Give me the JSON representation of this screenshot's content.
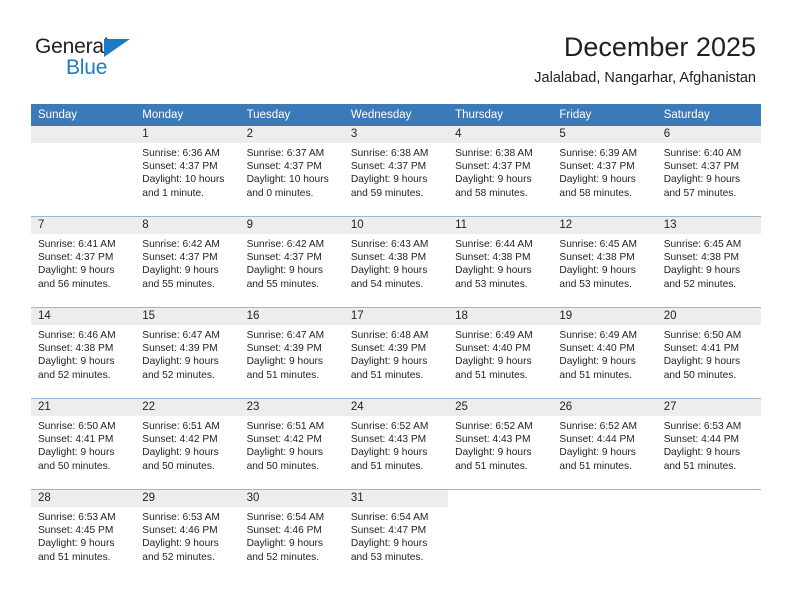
{
  "brand": {
    "name_top": "General",
    "name_bottom": "Blue"
  },
  "header": {
    "title": "December 2025",
    "subtitle": "Jalalabad, Nangarhar, Afghanistan",
    "accent_color": "#3a7ab8",
    "brand_blue": "#1a7dc4"
  },
  "calendar": {
    "weekday_headers": [
      "Sunday",
      "Monday",
      "Tuesday",
      "Wednesday",
      "Thursday",
      "Friday",
      "Saturday"
    ],
    "weeks": [
      [
        {
          "day": "",
          "empty": true
        },
        {
          "day": "1",
          "sunrise": "Sunrise: 6:36 AM",
          "sunset": "Sunset: 4:37 PM",
          "daylight_1": "Daylight: 10 hours",
          "daylight_2": "and 1 minute."
        },
        {
          "day": "2",
          "sunrise": "Sunrise: 6:37 AM",
          "sunset": "Sunset: 4:37 PM",
          "daylight_1": "Daylight: 10 hours",
          "daylight_2": "and 0 minutes."
        },
        {
          "day": "3",
          "sunrise": "Sunrise: 6:38 AM",
          "sunset": "Sunset: 4:37 PM",
          "daylight_1": "Daylight: 9 hours",
          "daylight_2": "and 59 minutes."
        },
        {
          "day": "4",
          "sunrise": "Sunrise: 6:38 AM",
          "sunset": "Sunset: 4:37 PM",
          "daylight_1": "Daylight: 9 hours",
          "daylight_2": "and 58 minutes."
        },
        {
          "day": "5",
          "sunrise": "Sunrise: 6:39 AM",
          "sunset": "Sunset: 4:37 PM",
          "daylight_1": "Daylight: 9 hours",
          "daylight_2": "and 58 minutes."
        },
        {
          "day": "6",
          "sunrise": "Sunrise: 6:40 AM",
          "sunset": "Sunset: 4:37 PM",
          "daylight_1": "Daylight: 9 hours",
          "daylight_2": "and 57 minutes."
        }
      ],
      [
        {
          "day": "7",
          "sunrise": "Sunrise: 6:41 AM",
          "sunset": "Sunset: 4:37 PM",
          "daylight_1": "Daylight: 9 hours",
          "daylight_2": "and 56 minutes."
        },
        {
          "day": "8",
          "sunrise": "Sunrise: 6:42 AM",
          "sunset": "Sunset: 4:37 PM",
          "daylight_1": "Daylight: 9 hours",
          "daylight_2": "and 55 minutes."
        },
        {
          "day": "9",
          "sunrise": "Sunrise: 6:42 AM",
          "sunset": "Sunset: 4:37 PM",
          "daylight_1": "Daylight: 9 hours",
          "daylight_2": "and 55 minutes."
        },
        {
          "day": "10",
          "sunrise": "Sunrise: 6:43 AM",
          "sunset": "Sunset: 4:38 PM",
          "daylight_1": "Daylight: 9 hours",
          "daylight_2": "and 54 minutes."
        },
        {
          "day": "11",
          "sunrise": "Sunrise: 6:44 AM",
          "sunset": "Sunset: 4:38 PM",
          "daylight_1": "Daylight: 9 hours",
          "daylight_2": "and 53 minutes."
        },
        {
          "day": "12",
          "sunrise": "Sunrise: 6:45 AM",
          "sunset": "Sunset: 4:38 PM",
          "daylight_1": "Daylight: 9 hours",
          "daylight_2": "and 53 minutes."
        },
        {
          "day": "13",
          "sunrise": "Sunrise: 6:45 AM",
          "sunset": "Sunset: 4:38 PM",
          "daylight_1": "Daylight: 9 hours",
          "daylight_2": "and 52 minutes."
        }
      ],
      [
        {
          "day": "14",
          "sunrise": "Sunrise: 6:46 AM",
          "sunset": "Sunset: 4:38 PM",
          "daylight_1": "Daylight: 9 hours",
          "daylight_2": "and 52 minutes."
        },
        {
          "day": "15",
          "sunrise": "Sunrise: 6:47 AM",
          "sunset": "Sunset: 4:39 PM",
          "daylight_1": "Daylight: 9 hours",
          "daylight_2": "and 52 minutes."
        },
        {
          "day": "16",
          "sunrise": "Sunrise: 6:47 AM",
          "sunset": "Sunset: 4:39 PM",
          "daylight_1": "Daylight: 9 hours",
          "daylight_2": "and 51 minutes."
        },
        {
          "day": "17",
          "sunrise": "Sunrise: 6:48 AM",
          "sunset": "Sunset: 4:39 PM",
          "daylight_1": "Daylight: 9 hours",
          "daylight_2": "and 51 minutes."
        },
        {
          "day": "18",
          "sunrise": "Sunrise: 6:49 AM",
          "sunset": "Sunset: 4:40 PM",
          "daylight_1": "Daylight: 9 hours",
          "daylight_2": "and 51 minutes."
        },
        {
          "day": "19",
          "sunrise": "Sunrise: 6:49 AM",
          "sunset": "Sunset: 4:40 PM",
          "daylight_1": "Daylight: 9 hours",
          "daylight_2": "and 51 minutes."
        },
        {
          "day": "20",
          "sunrise": "Sunrise: 6:50 AM",
          "sunset": "Sunset: 4:41 PM",
          "daylight_1": "Daylight: 9 hours",
          "daylight_2": "and 50 minutes."
        }
      ],
      [
        {
          "day": "21",
          "sunrise": "Sunrise: 6:50 AM",
          "sunset": "Sunset: 4:41 PM",
          "daylight_1": "Daylight: 9 hours",
          "daylight_2": "and 50 minutes."
        },
        {
          "day": "22",
          "sunrise": "Sunrise: 6:51 AM",
          "sunset": "Sunset: 4:42 PM",
          "daylight_1": "Daylight: 9 hours",
          "daylight_2": "and 50 minutes."
        },
        {
          "day": "23",
          "sunrise": "Sunrise: 6:51 AM",
          "sunset": "Sunset: 4:42 PM",
          "daylight_1": "Daylight: 9 hours",
          "daylight_2": "and 50 minutes."
        },
        {
          "day": "24",
          "sunrise": "Sunrise: 6:52 AM",
          "sunset": "Sunset: 4:43 PM",
          "daylight_1": "Daylight: 9 hours",
          "daylight_2": "and 51 minutes."
        },
        {
          "day": "25",
          "sunrise": "Sunrise: 6:52 AM",
          "sunset": "Sunset: 4:43 PM",
          "daylight_1": "Daylight: 9 hours",
          "daylight_2": "and 51 minutes."
        },
        {
          "day": "26",
          "sunrise": "Sunrise: 6:52 AM",
          "sunset": "Sunset: 4:44 PM",
          "daylight_1": "Daylight: 9 hours",
          "daylight_2": "and 51 minutes."
        },
        {
          "day": "27",
          "sunrise": "Sunrise: 6:53 AM",
          "sunset": "Sunset: 4:44 PM",
          "daylight_1": "Daylight: 9 hours",
          "daylight_2": "and 51 minutes."
        }
      ],
      [
        {
          "day": "28",
          "sunrise": "Sunrise: 6:53 AM",
          "sunset": "Sunset: 4:45 PM",
          "daylight_1": "Daylight: 9 hours",
          "daylight_2": "and 51 minutes."
        },
        {
          "day": "29",
          "sunrise": "Sunrise: 6:53 AM",
          "sunset": "Sunset: 4:46 PM",
          "daylight_1": "Daylight: 9 hours",
          "daylight_2": "and 52 minutes."
        },
        {
          "day": "30",
          "sunrise": "Sunrise: 6:54 AM",
          "sunset": "Sunset: 4:46 PM",
          "daylight_1": "Daylight: 9 hours",
          "daylight_2": "and 52 minutes."
        },
        {
          "day": "31",
          "sunrise": "Sunrise: 6:54 AM",
          "sunset": "Sunset: 4:47 PM",
          "daylight_1": "Daylight: 9 hours",
          "daylight_2": "and 53 minutes."
        },
        {
          "day": "",
          "blank": true
        },
        {
          "day": "",
          "blank": true
        },
        {
          "day": "",
          "blank": true
        }
      ]
    ]
  }
}
